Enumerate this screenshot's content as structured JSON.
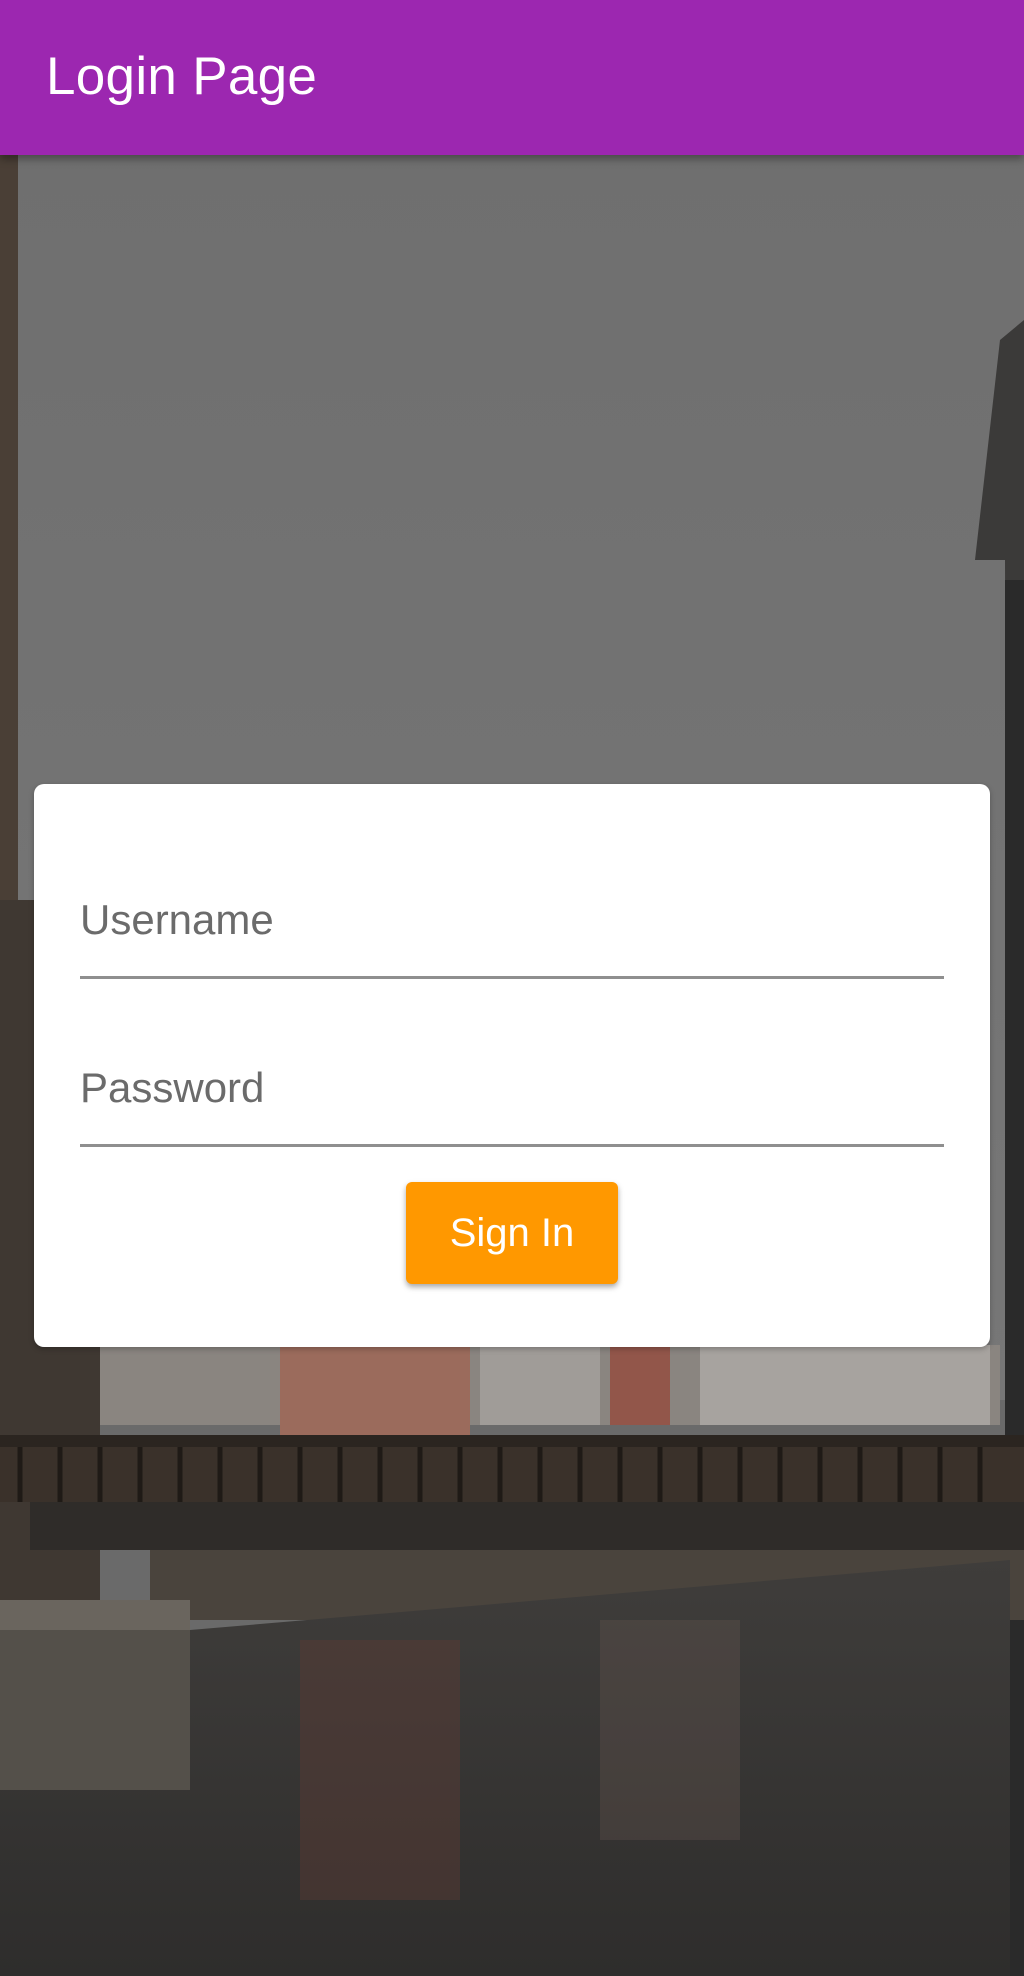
{
  "app_bar": {
    "title": "Login Page",
    "color": "#9c27b0"
  },
  "login_form": {
    "username": {
      "placeholder": "Username",
      "value": ""
    },
    "password": {
      "placeholder": "Password",
      "value": ""
    },
    "sign_in_label": "Sign In",
    "sign_in_color": "#ff9800"
  },
  "background": {
    "description_icon": "canal-bridge-photo"
  }
}
